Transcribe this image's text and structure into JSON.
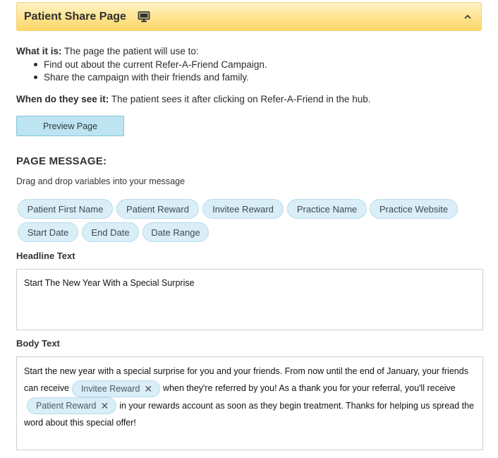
{
  "panel": {
    "title": "Patient Share Page",
    "icons": [
      "monitor-icon",
      "chevron-up-icon"
    ],
    "accent": "#fcd765"
  },
  "info": {
    "what_label": "What it is:",
    "what_text": "The page the patient will use to:",
    "bullets": [
      "Find out about the current Refer-A-Friend Campaign.",
      "Share the campaign with their friends and family."
    ],
    "when_label": "When do they see it:",
    "when_text": "The patient sees it after clicking on Refer-A-Friend in the hub."
  },
  "preview_button": {
    "label": "Preview Page"
  },
  "page_message": {
    "title": "PAGE MESSAGE:",
    "hint": "Drag and drop variables into your message",
    "variables": [
      "Patient First Name",
      "Patient Reward",
      "Invitee Reward",
      "Practice Name",
      "Practice Website",
      "Start Date",
      "End Date",
      "Date Range"
    ]
  },
  "headline": {
    "label": "Headline Text",
    "value": "Start The New Year With a Special Surprise"
  },
  "body": {
    "label": "Body Text",
    "segment1": "Start the new year with a special surprise for you and your friends. From now until the end of January, your friends can receive",
    "chip1": "Invitee Reward",
    "segment2": "when they're referred by you! As a thank you for your referral, you'll receive",
    "chip2": "Patient Reward",
    "segment3": "in your rewards account as soon as they begin treatment. Thanks for helping us spread the word about this special offer!"
  }
}
